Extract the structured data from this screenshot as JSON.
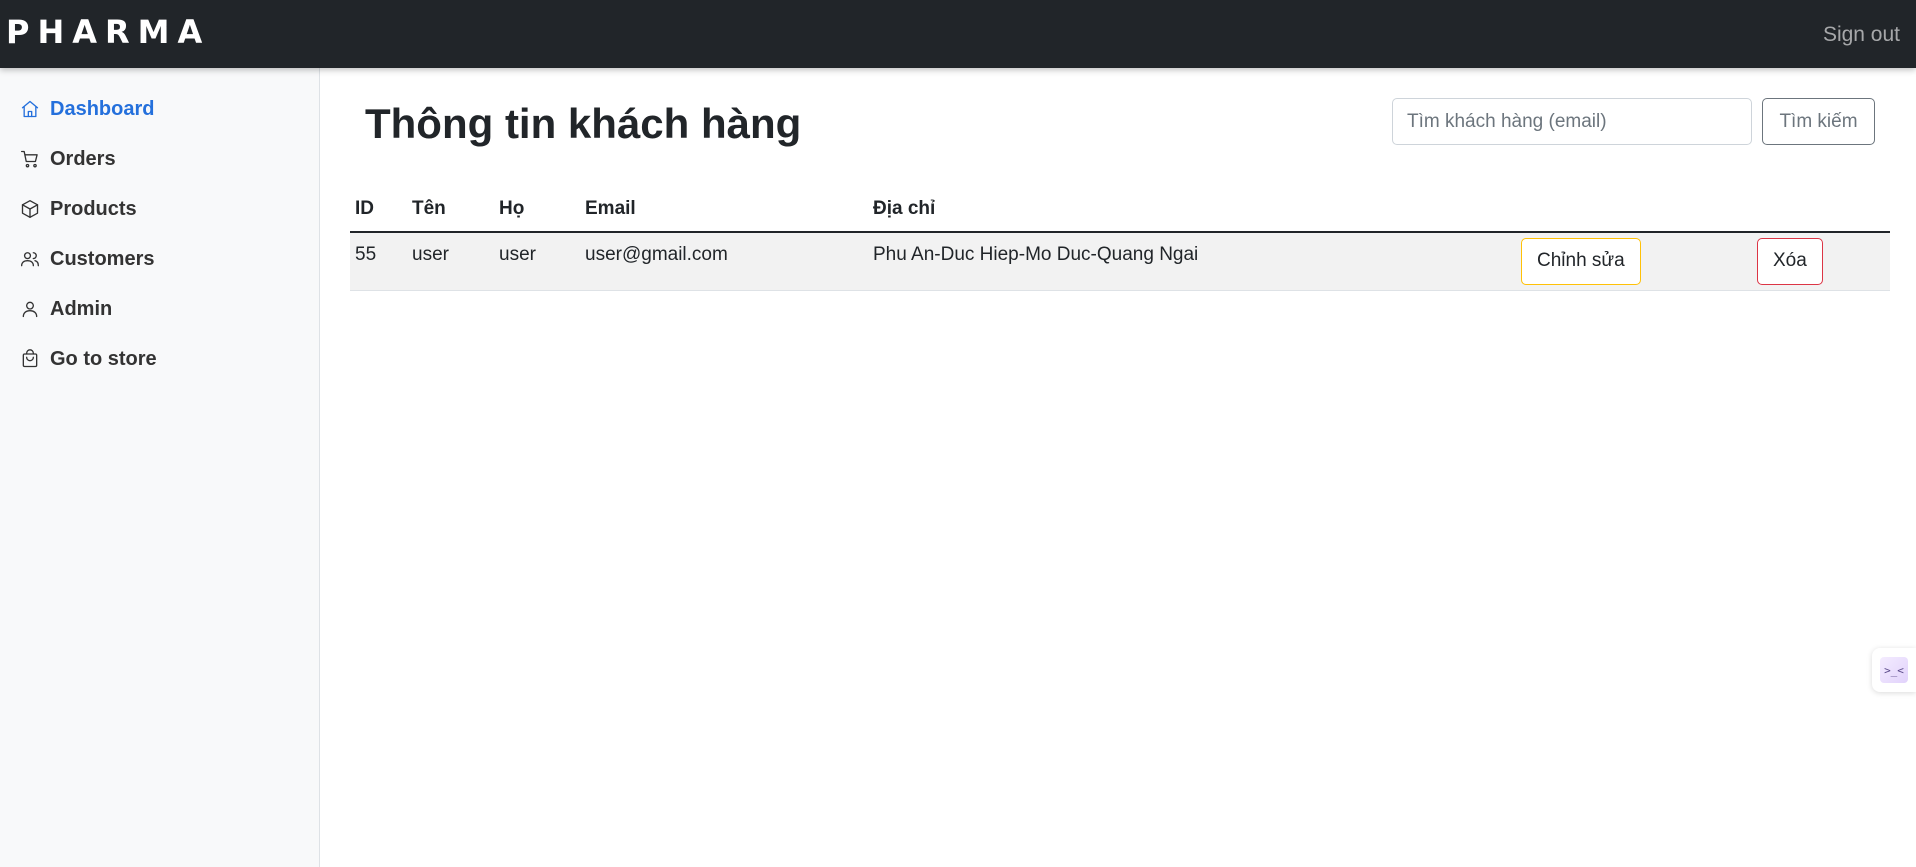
{
  "header": {
    "brand": "PHARMA",
    "signout_label": "Sign out"
  },
  "sidebar": {
    "items": [
      {
        "label": "Dashboard",
        "icon": "home-icon",
        "active": true
      },
      {
        "label": "Orders",
        "icon": "cart-icon"
      },
      {
        "label": "Products",
        "icon": "package-icon"
      },
      {
        "label": "Customers",
        "icon": "users-icon"
      },
      {
        "label": "Admin",
        "icon": "user-icon"
      },
      {
        "label": "Go to store",
        "icon": "shopping-bag-icon"
      }
    ]
  },
  "main": {
    "title": "Thông tin khách hàng",
    "search": {
      "placeholder": "Tìm khách hàng (email)",
      "value": "",
      "button_label": "Tìm kiếm"
    },
    "table": {
      "headers": [
        "ID",
        "Tên",
        "Họ",
        "Email",
        "Địa chỉ"
      ],
      "rows": [
        {
          "id": "55",
          "first_name": "user",
          "last_name": "user",
          "email": "user@gmail.com",
          "address": "Phu An-Duc Hiep-Mo Duc-Quang Ngai",
          "edit_label": "Chỉnh sửa",
          "delete_label": "Xóa"
        }
      ]
    }
  },
  "colors": {
    "topbar": "#212529",
    "sidebar_bg": "#f8f9fa",
    "active_link": "#2470dc",
    "edit_border": "#ffc107",
    "delete_border": "#dc3545"
  },
  "extension_widget": {
    "icon": "extension-icon",
    "glyph": ">_<"
  }
}
